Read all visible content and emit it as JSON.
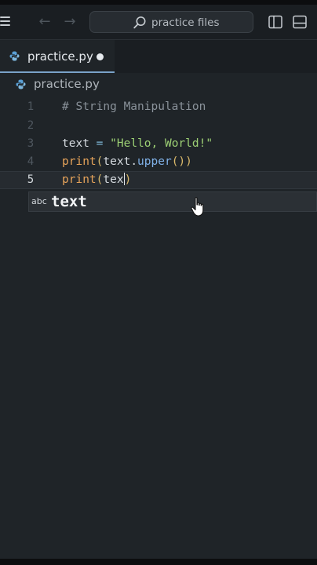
{
  "header": {
    "search_text": "practice files"
  },
  "tabs": [
    {
      "label": "practice.py",
      "modified": true,
      "active": true
    }
  ],
  "breadcrumb": {
    "file": "practice.py"
  },
  "editor": {
    "current_line": 5,
    "lines": [
      {
        "number": "1",
        "text": "# String Manipulation"
      },
      {
        "number": "2",
        "text": ""
      },
      {
        "number": "3",
        "text": "text = \"Hello, World!\""
      },
      {
        "number": "4",
        "text": "print(text.upper())"
      },
      {
        "number": "5",
        "text": "print(tex)"
      }
    ]
  },
  "suggest": {
    "kind": "abc",
    "label": "text"
  },
  "colors": {
    "background": "#1f2428",
    "accent": "#7aa2c8",
    "string": "#9ccf74",
    "function": "#e6a35a",
    "comment": "#8a929a"
  }
}
